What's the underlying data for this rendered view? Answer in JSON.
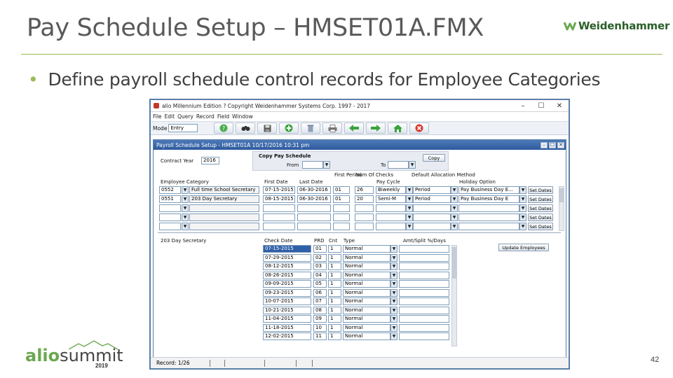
{
  "slide": {
    "title": "Pay Schedule Setup – HMSET01A.FMX",
    "bullet": "Define payroll schedule control records for Employee Categories",
    "logo_right_text": "Weidenhammer",
    "logo_left_text": "alio",
    "logo_left_text2": "summit",
    "logo_left_year": "2019",
    "page_number": "42",
    "accent_color": "#9bbb59"
  },
  "window": {
    "title": "alio Millennium Edition ? Copyright Weidenhammer Systems Corp. 1997 - 2017",
    "controls": [
      "–",
      "☐",
      "✕"
    ],
    "menu": [
      "File",
      "Edit",
      "Query",
      "Record",
      "Field",
      "Window"
    ],
    "mode_label": "Mode",
    "mode_value": "Entry",
    "toolbar_icons": [
      "help-icon",
      "binoculars-icon",
      "save-icon",
      "add-icon",
      "delete-icon",
      "print-icon",
      "back-arrow-icon",
      "forward-arrow-icon",
      "home-icon",
      "close-icon"
    ]
  },
  "form": {
    "title": "Payroll Schedule Setup - HMSET01A     10/17/2016   10:31 pm",
    "contract_year_label": "Contract Year",
    "contract_year_value": "2016",
    "copy_title": "Copy Pay Schedule",
    "copy_from_label": "From",
    "copy_to_label": "To",
    "copy_button": "Copy",
    "headers": {
      "employee_category": "Employee Category",
      "first_date": "First Date",
      "last_date": "Last Date",
      "first_period": "First Period",
      "num_checks": "Num Of Checks",
      "pay_cycle": "Pay Cycle",
      "default_allocation": "Default Allocation Method",
      "holiday_option": "Holiday Option"
    },
    "category_rows": [
      {
        "code": "0552",
        "name": "Full time School Secretary",
        "first": "07-15-2015",
        "last": "06-30-2016",
        "period": "01",
        "checks": "26",
        "cycle": "Biweekly",
        "alloc": "Period",
        "holiday": "Pay Business Day E...",
        "btn": "Set Dates"
      },
      {
        "code": "0551",
        "name": "203 Day Secretary",
        "first": "08-15-2015",
        "last": "06-30-2016",
        "period": "01",
        "checks": "20",
        "cycle": "Semi-M",
        "alloc": "Period",
        "holiday": "Pay Business Day E",
        "btn": "Set Dates"
      },
      {
        "code": "",
        "name": "",
        "first": "",
        "last": "",
        "period": "",
        "checks": "",
        "cycle": "",
        "alloc": "",
        "holiday": "",
        "btn": "Set Dates"
      },
      {
        "code": "",
        "name": "",
        "first": "",
        "last": "",
        "period": "",
        "checks": "",
        "cycle": "",
        "alloc": "",
        "holiday": "",
        "btn": "Set Dates"
      },
      {
        "code": "",
        "name": "",
        "first": "",
        "last": "",
        "period": "",
        "checks": "",
        "cycle": "",
        "alloc": "",
        "holiday": "",
        "btn": "Set Dates"
      }
    ],
    "detail_category": "203 Day Secretary",
    "detail_headers": {
      "check_date": "Check Date",
      "prd": "PRD",
      "cnt": "Cnt",
      "type": "Type",
      "amt_split": "Amt/Split %/Days"
    },
    "update_button": "Update Employees",
    "check_rows": [
      {
        "date": "07-15-2015",
        "prd": "01",
        "cnt": "1",
        "type": "Normal"
      },
      {
        "date": "07-29-2015",
        "prd": "02",
        "cnt": "1",
        "type": "Normal"
      },
      {
        "date": "08-12-2015",
        "prd": "03",
        "cnt": "1",
        "type": "Normal"
      },
      {
        "date": "08-26-2015",
        "prd": "04",
        "cnt": "1",
        "type": "Normal"
      },
      {
        "date": "09-09-2015",
        "prd": "05",
        "cnt": "1",
        "type": "Normal"
      },
      {
        "date": "09-23-2015",
        "prd": "06",
        "cnt": "1",
        "type": "Normal"
      },
      {
        "date": "10-07-2015",
        "prd": "07",
        "cnt": "1",
        "type": "Normal"
      },
      {
        "date": "10-21-2015",
        "prd": "08",
        "cnt": "1",
        "type": "Normal"
      },
      {
        "date": "11-04-2015",
        "prd": "09",
        "cnt": "1",
        "type": "Normal"
      },
      {
        "date": "11-18-2015",
        "prd": "10",
        "cnt": "1",
        "type": "Normal"
      },
      {
        "date": "12-02-2015",
        "prd": "11",
        "cnt": "1",
        "type": "Normal"
      }
    ],
    "status_record": "Record: 1/26"
  }
}
